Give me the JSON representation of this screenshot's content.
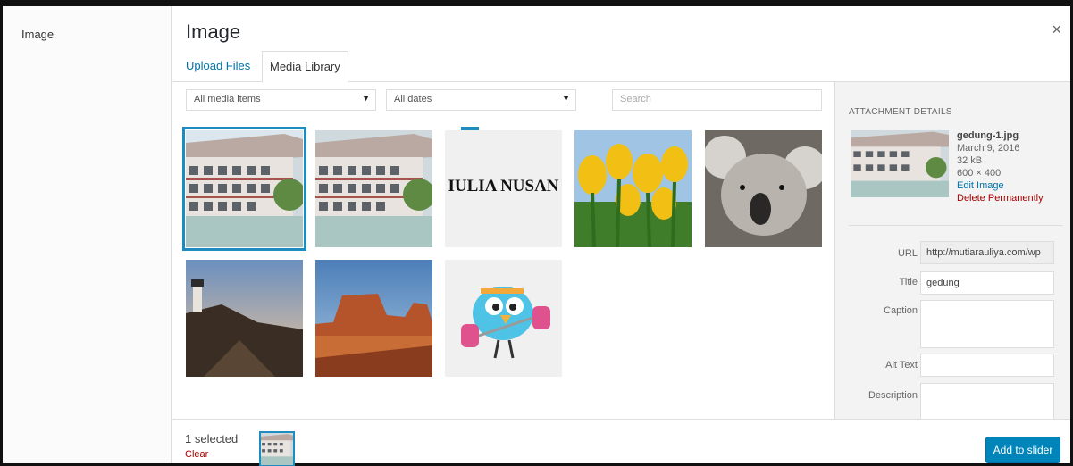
{
  "left_panel": {
    "title": "Image"
  },
  "modal": {
    "title": "Image",
    "close_glyph": "×",
    "tabs": [
      {
        "label": "Upload Files",
        "active": false
      },
      {
        "label": "Media Library",
        "active": true
      }
    ]
  },
  "filters": {
    "media_type": "All media items",
    "date": "All dates",
    "search_placeholder": "Search",
    "dropdown_arrow": "▼"
  },
  "grid": {
    "items": [
      {
        "kind": "building",
        "selected": true
      },
      {
        "kind": "building",
        "selected": false
      },
      {
        "kind": "logo-text",
        "text": "IULIA NUSAN",
        "selected": false
      },
      {
        "kind": "tulips",
        "selected": false
      },
      {
        "kind": "koala",
        "selected": false
      },
      {
        "kind": "lighthouse",
        "selected": false
      },
      {
        "kind": "desert",
        "selected": false
      },
      {
        "kind": "bird",
        "selected": false
      }
    ],
    "check_glyph": "✓"
  },
  "attachment": {
    "heading": "ATTACHMENT DETAILS",
    "filename": "gedung-1.jpg",
    "date": "March 9, 2016",
    "size": "32 kB",
    "dimensions": "600 × 400",
    "edit_label": "Edit Image",
    "delete_label": "Delete Permanently",
    "fields": {
      "url": {
        "label": "URL",
        "value": "http://mutiarauliya.com/wp"
      },
      "title": {
        "label": "Title",
        "value": "gedung"
      },
      "caption": {
        "label": "Caption",
        "value": ""
      },
      "alt": {
        "label": "Alt Text",
        "value": ""
      },
      "description": {
        "label": "Description",
        "value": ""
      }
    }
  },
  "toolbar": {
    "selected_count": "1 selected",
    "clear_label": "Clear",
    "add_label": "Add to slider"
  },
  "colors": {
    "accent": "#1e8cbe",
    "primary_button": "#0085ba",
    "danger": "#a00000"
  }
}
